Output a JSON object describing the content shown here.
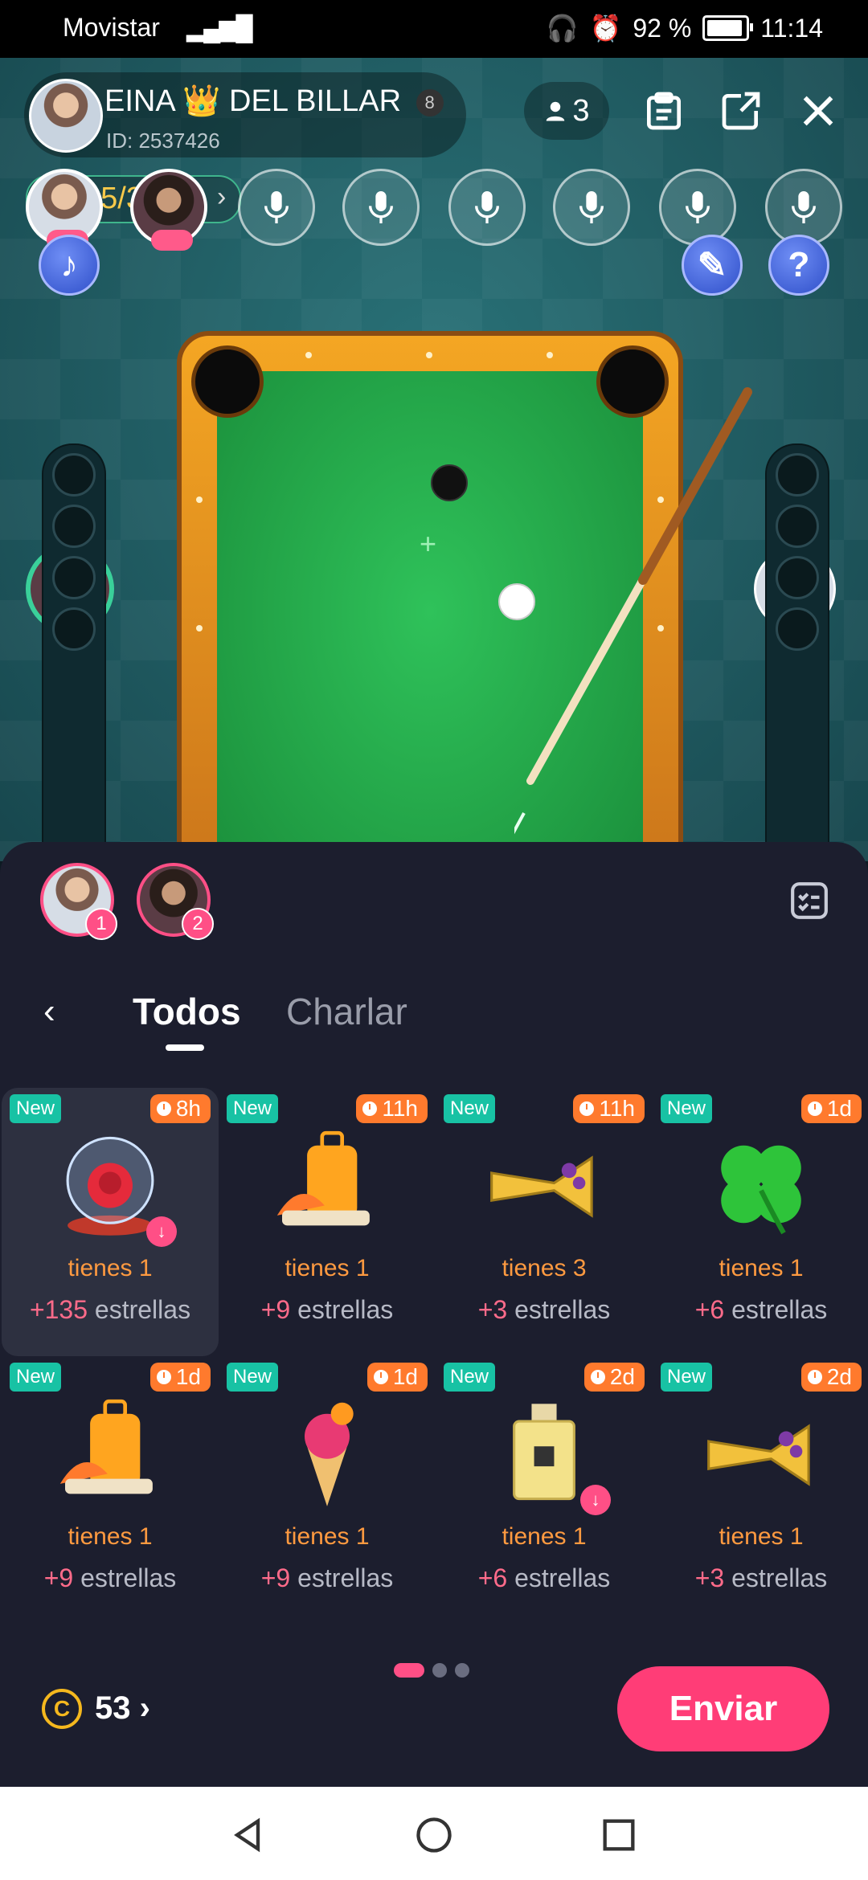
{
  "status": {
    "carrier": "Movistar",
    "signal": "▂▄▆█",
    "battery": "92 %",
    "time": "11:14"
  },
  "room": {
    "name": "EINA 👑 DEL BILLAR",
    "ball": "8",
    "id": "ID: 2537426",
    "users_count": "3",
    "level_num": "2",
    "level_progress": "25/3000",
    "chev": "›"
  },
  "panel": {
    "back": "‹",
    "tabs": [
      "Todos",
      "Charlar"
    ],
    "selected": [
      "1",
      "2"
    ],
    "gifts": [
      {
        "new": "New",
        "time": "8h",
        "have": "tienes 1",
        "plus": "+135",
        "stars": "estrellas",
        "art": "rose",
        "download": "↓"
      },
      {
        "new": "New",
        "time": "11h",
        "have": "tienes 1",
        "plus": "+9",
        "stars": "estrellas",
        "art": "suitcase",
        "download": ""
      },
      {
        "new": "New",
        "time": "11h",
        "have": "tienes 3",
        "plus": "+3",
        "stars": "estrellas",
        "art": "trumpet",
        "download": ""
      },
      {
        "new": "New",
        "time": "1d",
        "have": "tienes 1",
        "plus": "+6",
        "stars": "estrellas",
        "art": "clover",
        "download": ""
      },
      {
        "new": "New",
        "time": "1d",
        "have": "tienes 1",
        "plus": "+9",
        "stars": "estrellas",
        "art": "suitcase",
        "download": ""
      },
      {
        "new": "New",
        "time": "1d",
        "have": "tienes 1",
        "plus": "+9",
        "stars": "estrellas",
        "art": "icecream",
        "download": ""
      },
      {
        "new": "New",
        "time": "2d",
        "have": "tienes 1",
        "plus": "+6",
        "stars": "estrellas",
        "art": "perfume",
        "download": "↓"
      },
      {
        "new": "New",
        "time": "2d",
        "have": "tienes 1",
        "plus": "+3",
        "stars": "estrellas",
        "art": "trumpet",
        "download": ""
      }
    ],
    "coin_symbol": "C",
    "coins": "53 ›",
    "send": "Enviar"
  },
  "colors": {
    "accent": "#ff3d77",
    "new_badge": "#18c2a4",
    "time_badge": "#ff7a2d",
    "have_text": "#ff9a40"
  }
}
